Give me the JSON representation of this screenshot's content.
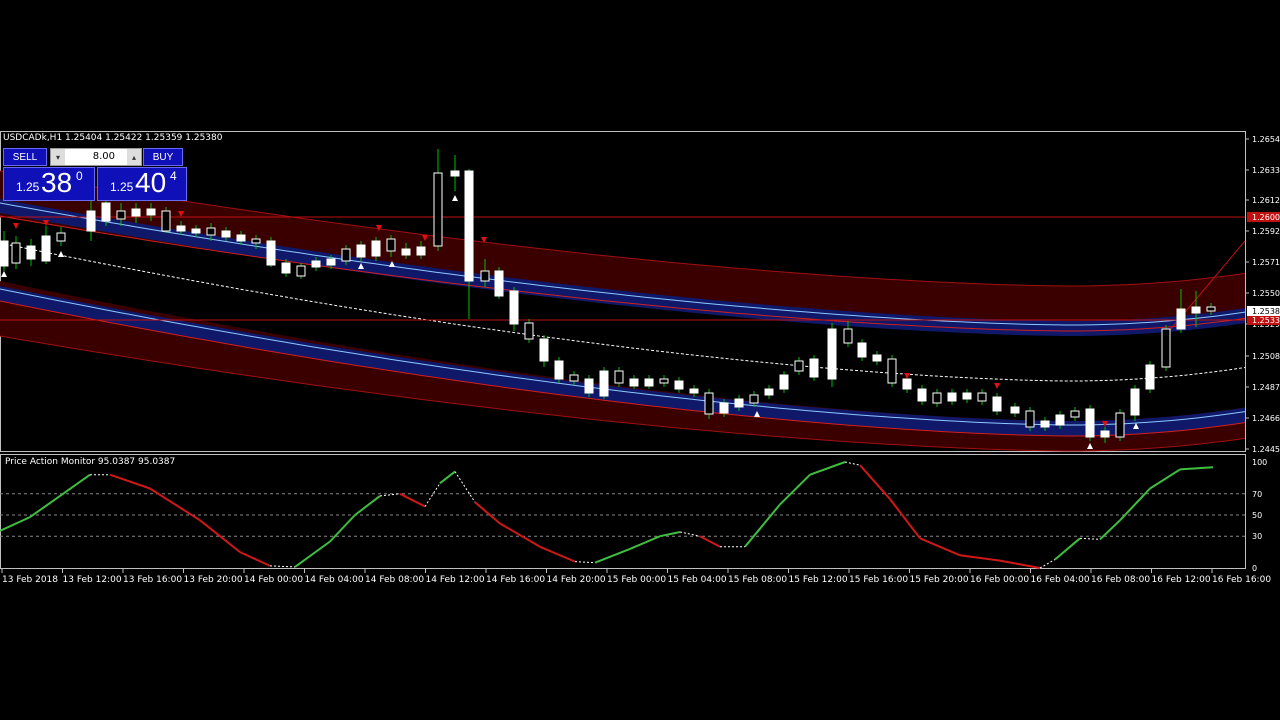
{
  "chart": {
    "symbol_header": "USDCADk,H1  1.25404 1.25422 1.25359 1.25380",
    "price_ticks": [
      "1.26545",
      "1.26335",
      "1.26125",
      "1.25920",
      "1.25710",
      "1.25500",
      "1.25290",
      "1.25080",
      "1.24875",
      "1.24665",
      "1.24455"
    ],
    "current_price": "1.25380",
    "red_line_price": "1.26000",
    "red_line_price2": "1.25330",
    "colors": {
      "bull": "#ffffff",
      "bear": "#ffffff",
      "wick": "#00c000",
      "channel": "#3a0000",
      "mid": "#ffffff",
      "band_blue": "#10186a"
    }
  },
  "trade_panel": {
    "sell_label": "SELL",
    "buy_label": "BUY",
    "lot_value": "8.00",
    "bid_prefix": "1.25",
    "bid_big": "38",
    "bid_sup": "0",
    "ask_prefix": "1.25",
    "ask_big": "40",
    "ask_sup": "4"
  },
  "indicator": {
    "label": "Price Action Monitor 95.0387 95.0387",
    "levels": [
      "100",
      "70",
      "50",
      "30",
      "0"
    ],
    "colors": {
      "up": "#3fbf3f",
      "down": "#d01818",
      "neutral": "#ffffff"
    }
  },
  "time_axis": [
    "13 Feb 2018",
    "13 Feb 12:00",
    "13 Feb 16:00",
    "13 Feb 20:00",
    "14 Feb 00:00",
    "14 Feb 04:00",
    "14 Feb 08:00",
    "14 Feb 12:00",
    "14 Feb 16:00",
    "14 Feb 20:00",
    "15 Feb 00:00",
    "15 Feb 04:00",
    "15 Feb 08:00",
    "15 Feb 12:00",
    "15 Feb 16:00",
    "15 Feb 20:00",
    "16 Feb 00:00",
    "16 Feb 04:00",
    "16 Feb 08:00",
    "16 Feb 12:00",
    "16 Feb 16:00"
  ]
}
